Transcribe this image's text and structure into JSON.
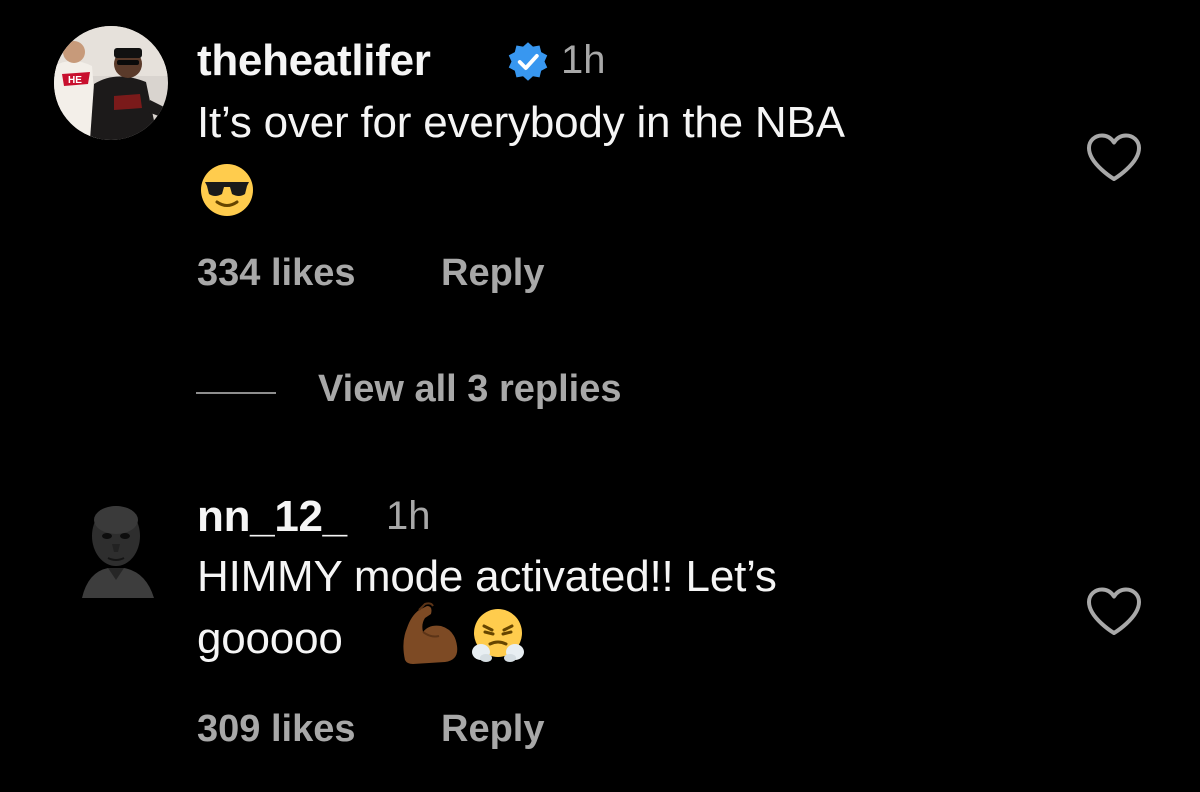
{
  "comments": [
    {
      "username": "theheatlifer",
      "verified": true,
      "time": "1h",
      "text_line1": "It’s over for everybody in the NBA",
      "emojis_line2": [
        "smiling-face-with-sunglasses"
      ],
      "likes": "334 likes",
      "reply_label": "Reply"
    },
    {
      "username": "nn_12_",
      "verified": false,
      "time": "1h",
      "text_line1": "HIMMY mode activated!! Let’s",
      "text_line2": "gooooo",
      "emojis_line2": [
        "flexed-biceps",
        "face-with-steam-from-nose"
      ],
      "likes": "309 likes",
      "reply_label": "Reply"
    }
  ],
  "view_replies": {
    "label": "View all 3 replies"
  },
  "colors": {
    "background": "#000000",
    "primary_text": "#f5f5f5",
    "secondary_text": "#a8a8a8",
    "verified_badge": "#3897f0"
  }
}
